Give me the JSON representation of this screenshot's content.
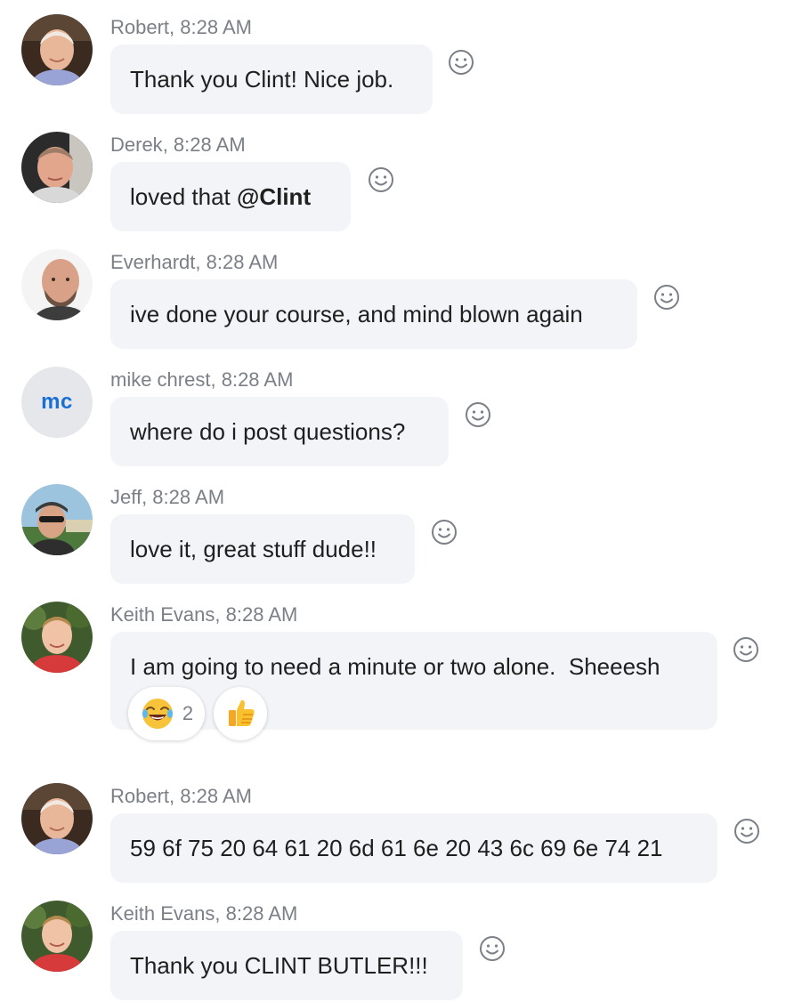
{
  "messages": [
    {
      "author": "Robert",
      "time": "8:28 AM",
      "text": "Thank you Clint! Nice job."
    },
    {
      "author": "Derek",
      "time": "8:28 AM",
      "text": "loved that ",
      "mention": "@Clint"
    },
    {
      "author": "Everhardt",
      "time": "8:28 AM",
      "text": "ive done your course, and mind blown again"
    },
    {
      "author": "mike chrest",
      "time": "8:28 AM",
      "initials": "mc",
      "text": "where do i post questions?"
    },
    {
      "author": "Jeff",
      "time": "8:28 AM",
      "text": "love it, great stuff dude!!"
    },
    {
      "author": "Keith Evans",
      "time": "8:28 AM",
      "text": "I am going to need a minute or two alone.  Sheeesh",
      "reactions": [
        {
          "emoji": "joy-emoji",
          "count": "2"
        },
        {
          "emoji": "thumbs-up-emoji",
          "count": ""
        }
      ]
    },
    {
      "author": "Robert",
      "time": "8:28 AM",
      "text": "59 6f 75 20 64 61 20 6d 61 6e 20 43 6c 69 6e 74 21"
    },
    {
      "author": "Keith Evans",
      "time": "8:28 AM",
      "text": "Thank you CLINT BUTLER!!!"
    }
  ],
  "colors": {
    "bubble": "#f2f4f7",
    "meta_text": "#7b7f86",
    "initials_text": "#1a6fd6",
    "initials_bg": "#e6e7ea"
  },
  "icons": {
    "react": "smiley-outline-icon"
  }
}
